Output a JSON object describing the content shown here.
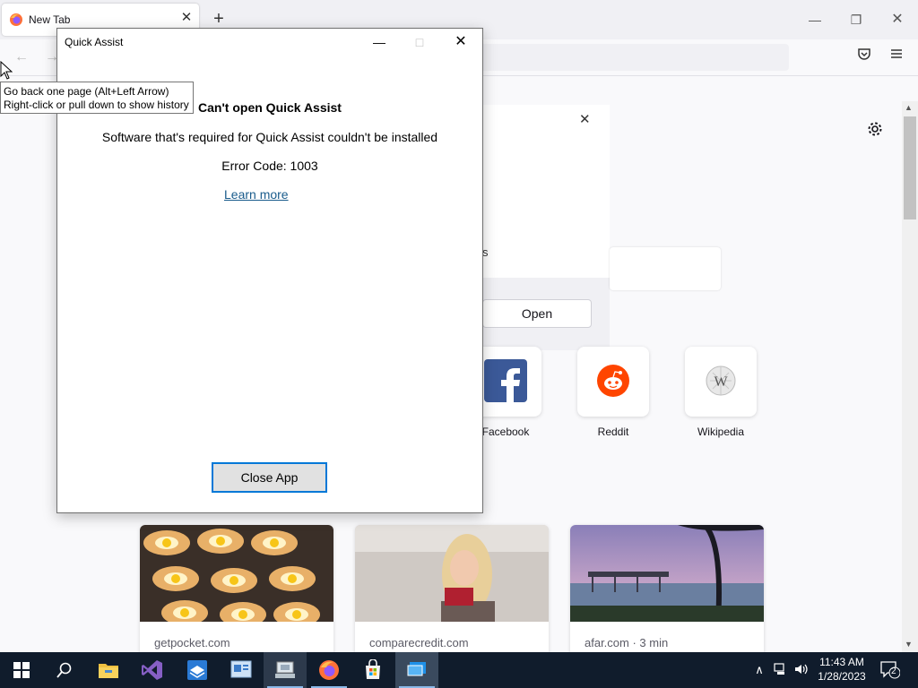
{
  "browser": {
    "tab_title": "New Tab",
    "new_tab_symbol": "+",
    "tab_close_symbol": "✕"
  },
  "newtab_page": {
    "promo_partial_text": "s",
    "open_button": "Open",
    "top_sites": [
      {
        "label": "Facebook",
        "icon": "facebook-icon",
        "color": "#3b5998"
      },
      {
        "label": "Reddit",
        "icon": "reddit-icon",
        "color": "#ff4500"
      },
      {
        "label": "Wikipedia",
        "icon": "wikipedia-icon",
        "color": "#cccccc"
      }
    ],
    "stories": [
      {
        "source": "getpocket.com"
      },
      {
        "source": "comparecredit.com"
      },
      {
        "source": "afar.com · 3 min"
      }
    ]
  },
  "tooltip": {
    "line1": "Go back one page (Alt+Left Arrow)",
    "line2": "Right-click or pull down to show history"
  },
  "quick_assist": {
    "window_title": "Quick Assist",
    "heading": "Can't open Quick Assist",
    "message": "Software that's required for Quick Assist couldn't be installed",
    "error_code": "Error Code: 1003",
    "learn_more": "Learn more",
    "close_app": "Close App"
  },
  "taskbar": {
    "time": "11:43 AM",
    "date": "1/28/2023",
    "notification_count": "2",
    "apps": [
      "start-icon",
      "search-icon",
      "file-explorer-icon",
      "visual-studio-icon",
      "sandbox-icon",
      "control-panel-icon",
      "network-icon",
      "firefox-icon",
      "store-icon",
      "quick-assist-icon"
    ]
  },
  "colors": {
    "taskbar": "#101c2c",
    "accent": "#0078d7",
    "link": "#1a5c8c"
  }
}
